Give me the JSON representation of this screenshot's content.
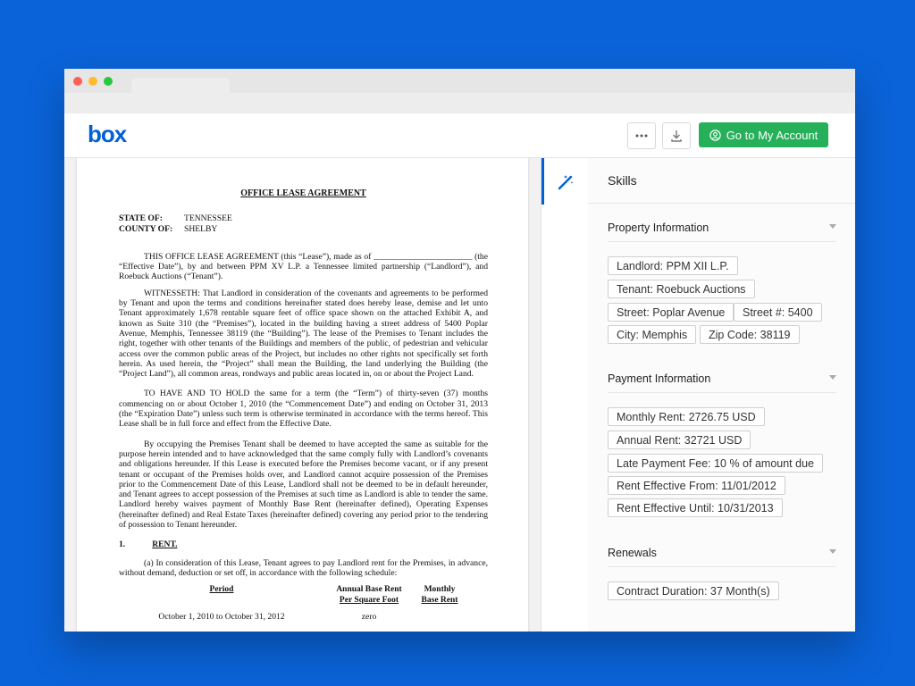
{
  "header": {
    "logo": "box",
    "go_button_label": "Go to My Account"
  },
  "document": {
    "title": "OFFICE LEASE AGREEMENT",
    "state_label": "STATE OF:",
    "state_value": "TENNESSEE",
    "county_label": "COUNTY OF:",
    "county_value": "SHELBY",
    "para1": "THIS OFFICE LEASE AGREEMENT (this “Lease”), made as of _______________________ (the “Effective Date”), by and between PPM XV L.P. a Tennessee limited partnership (“Landlord”), and Roebuck Auctions (“Tenant”).",
    "para2": "WITNESSETH: That Landlord in consideration of the covenants and agreements to be performed by Tenant and upon the terms and conditions hereinafter stated does hereby lease, demise and let unto Tenant approximately 1,678 rentable square feet of office space shown on the attached Exhibit A, and known as Suite 310 (the “Premises”), located in the building having a street address of 5400 Poplar Avenue, Memphis, Tennessee 38119 (the “Building”). The lease of the Premises to Tenant includes the right, together with other tenants of the Buildings and members of the public, of pedestrian and vehicular access over the common public areas of the Project, but includes no other rights not specifically set forth herein. As used herein, the “Project” shall mean the Building, the land underlying the Building (the “Project Land”), all common areas, rondways and public areas located in, on or about the Project Land.",
    "para3": "TO HAVE AND TO HOLD the same for a term (the “Term”) of thirty-seven (37) months commencing on or about October 1, 2010 (the “Commencement Date”) and ending on October 31, 2013 (the “Expiration Date”) unless such term is otherwise terminated in accordance with the terms hereof. This Lease shall be in full force and effect from the Effective Date.",
    "para4": "By occupying the Premises Tenant shall be deemed to have accepted the same as suitable for the purpose herein intended and to have acknowledged that the same comply fully with Landlord’s covenants and obligations hereunder. If this Lease is executed before the Premises become vacant, or if any present tenant or occupant of the Premises holds over, and Landlord cannot acquire possession of the Premises prior to the Commencement Date of this Lease, Landlord shall not be deemed to be in default hereunder, and Tenant agrees to accept possession of the Premises at such time as Landlord is able to tender the same. Landlord hereby waives payment of Monthly Base Rent (hereinafter defined), Operating Expenses (hereinafter defined) and Real Estate Taxes (hereinafter defined) covering any period prior to the tendering of possession to Tenant hereunder.",
    "section_number": "1.",
    "section_title": "RENT.",
    "para5": "(a) In consideration of this Lease, Tenant agrees to pay Landlord rent for the Premises, in advance, without demand, deduction or set off, in accordance with the following schedule:",
    "schedule_headers": {
      "period": "Period",
      "annual_line1": "Annual Base Rent",
      "annual_line2": "Per Square Foot",
      "monthly_line1": "Monthly",
      "monthly_line2": "Base Rent"
    },
    "schedule_row": {
      "period": "October 1, 2010 to October 31, 2012",
      "annual": "zero"
    }
  },
  "skills": {
    "title": "Skills",
    "sections": [
      {
        "title": "Property Information",
        "chips": [
          "Landlord: PPM XII L.P.",
          "Tenant: Roebuck Auctions",
          "Street: Poplar Avenue",
          "Street #: 5400",
          "City: Memphis",
          "Zip Code: 38119"
        ]
      },
      {
        "title": "Payment Information",
        "chips": [
          "Monthly Rent: 2726.75 USD",
          "Annual Rent: 32721 USD",
          "Late Payment Fee: 10 % of amount due",
          "Rent Effective From: 11/01/2012",
          "Rent Effective Until: 10/31/2013"
        ]
      },
      {
        "title": "Renewals",
        "chips": [
          "Contract Duration: 37 Month(s)"
        ]
      }
    ]
  },
  "colors": {
    "background": "#0a63d8",
    "brand": "#0061d5",
    "go_button": "#26b05a",
    "mac_red": "#ff5f57",
    "mac_yellow": "#febc2e",
    "mac_green": "#28c840"
  }
}
